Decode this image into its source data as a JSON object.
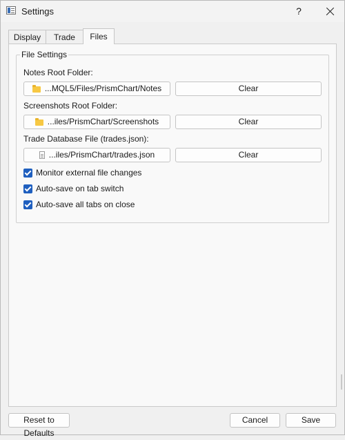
{
  "window": {
    "title": "Settings",
    "help_label": "?"
  },
  "tabs": [
    {
      "label": "Display",
      "active": false
    },
    {
      "label": "Trade",
      "active": false
    },
    {
      "label": "Files",
      "active": true
    }
  ],
  "file_settings": {
    "group_title": "File Settings",
    "notes": {
      "label": "Notes Root Folder:",
      "path": "...MQL5/Files/PrismChart/Notes",
      "icon": "folder-icon",
      "clear_label": "Clear"
    },
    "screenshots": {
      "label": "Screenshots Root Folder:",
      "path": "...iles/PrismChart/Screenshots",
      "icon": "folder-icon",
      "clear_label": "Clear"
    },
    "trades": {
      "label": "Trade Database File (trades.json):",
      "path": "...iles/PrismChart/trades.json",
      "icon": "file-icon",
      "clear_label": "Clear"
    },
    "checkboxes": [
      {
        "label": "Monitor external file changes",
        "checked": true
      },
      {
        "label": "Auto-save on tab switch",
        "checked": true
      },
      {
        "label": "Auto-save all tabs on close",
        "checked": true
      }
    ]
  },
  "footer": {
    "reset_label": "Reset to Defaults",
    "cancel_label": "Cancel",
    "save_label": "Save"
  },
  "colors": {
    "accent": "#1f5fbf",
    "window_bg": "#f0f0f0",
    "panel_bg": "#f9f9f9"
  }
}
